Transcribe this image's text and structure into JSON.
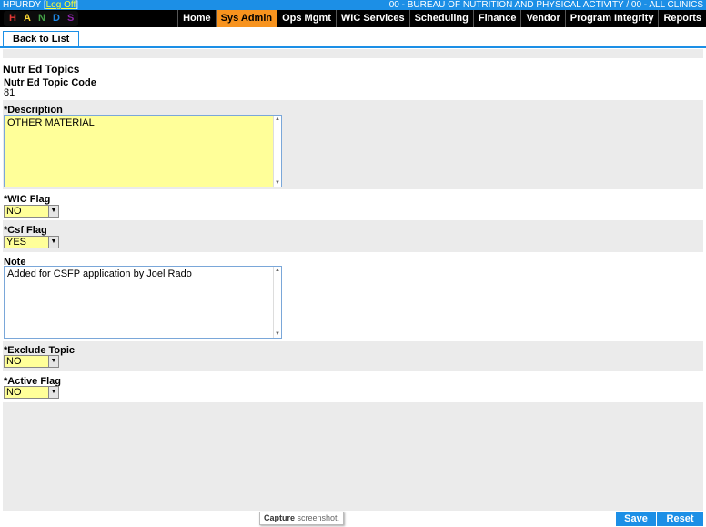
{
  "header": {
    "user": "HPURDY",
    "logoff": "Log Off",
    "org": "00 - BUREAU OF NUTRITION AND PHYSICAL ACTIVITY / 00 - ALL CLINICS"
  },
  "logo": {
    "letters": [
      "H",
      "A",
      "N",
      "D",
      "S"
    ],
    "colors": [
      "#e53935",
      "#fdd835",
      "#43a047",
      "#1e88e5",
      "#8e24aa"
    ]
  },
  "nav": {
    "items": [
      "Home",
      "Sys Admin",
      "Ops Mgmt",
      "WIC Services",
      "Scheduling",
      "Finance",
      "Vendor",
      "Program Integrity",
      "Reports"
    ],
    "active": "Sys Admin"
  },
  "toolbar": {
    "back_label": "Back to List"
  },
  "page": {
    "title": "Nutr Ed Topics"
  },
  "form": {
    "code_label": "Nutr Ed Topic Code",
    "code_value": "81",
    "description_label": "*Description",
    "description_value": "OTHER MATERIAL",
    "wic_flag_label": "*WIC Flag",
    "wic_flag_value": "NO",
    "csf_flag_label": "*Csf Flag",
    "csf_flag_value": "YES",
    "note_label": "Note",
    "note_value": "Added for CSFP application by Joel Rado",
    "exclude_topic_label": "*Exclude Topic",
    "exclude_topic_value": "NO",
    "active_flag_label": "*Active Flag",
    "active_flag_value": "NO"
  },
  "tooltip": {
    "bold": "Capture",
    "rest": " screenshot."
  },
  "footer": {
    "save_label": "Save",
    "reset_label": "Reset"
  },
  "colors": {
    "accent": "#1c8fe6",
    "active_tab": "#f7931e",
    "required_field": "#ffff99"
  }
}
